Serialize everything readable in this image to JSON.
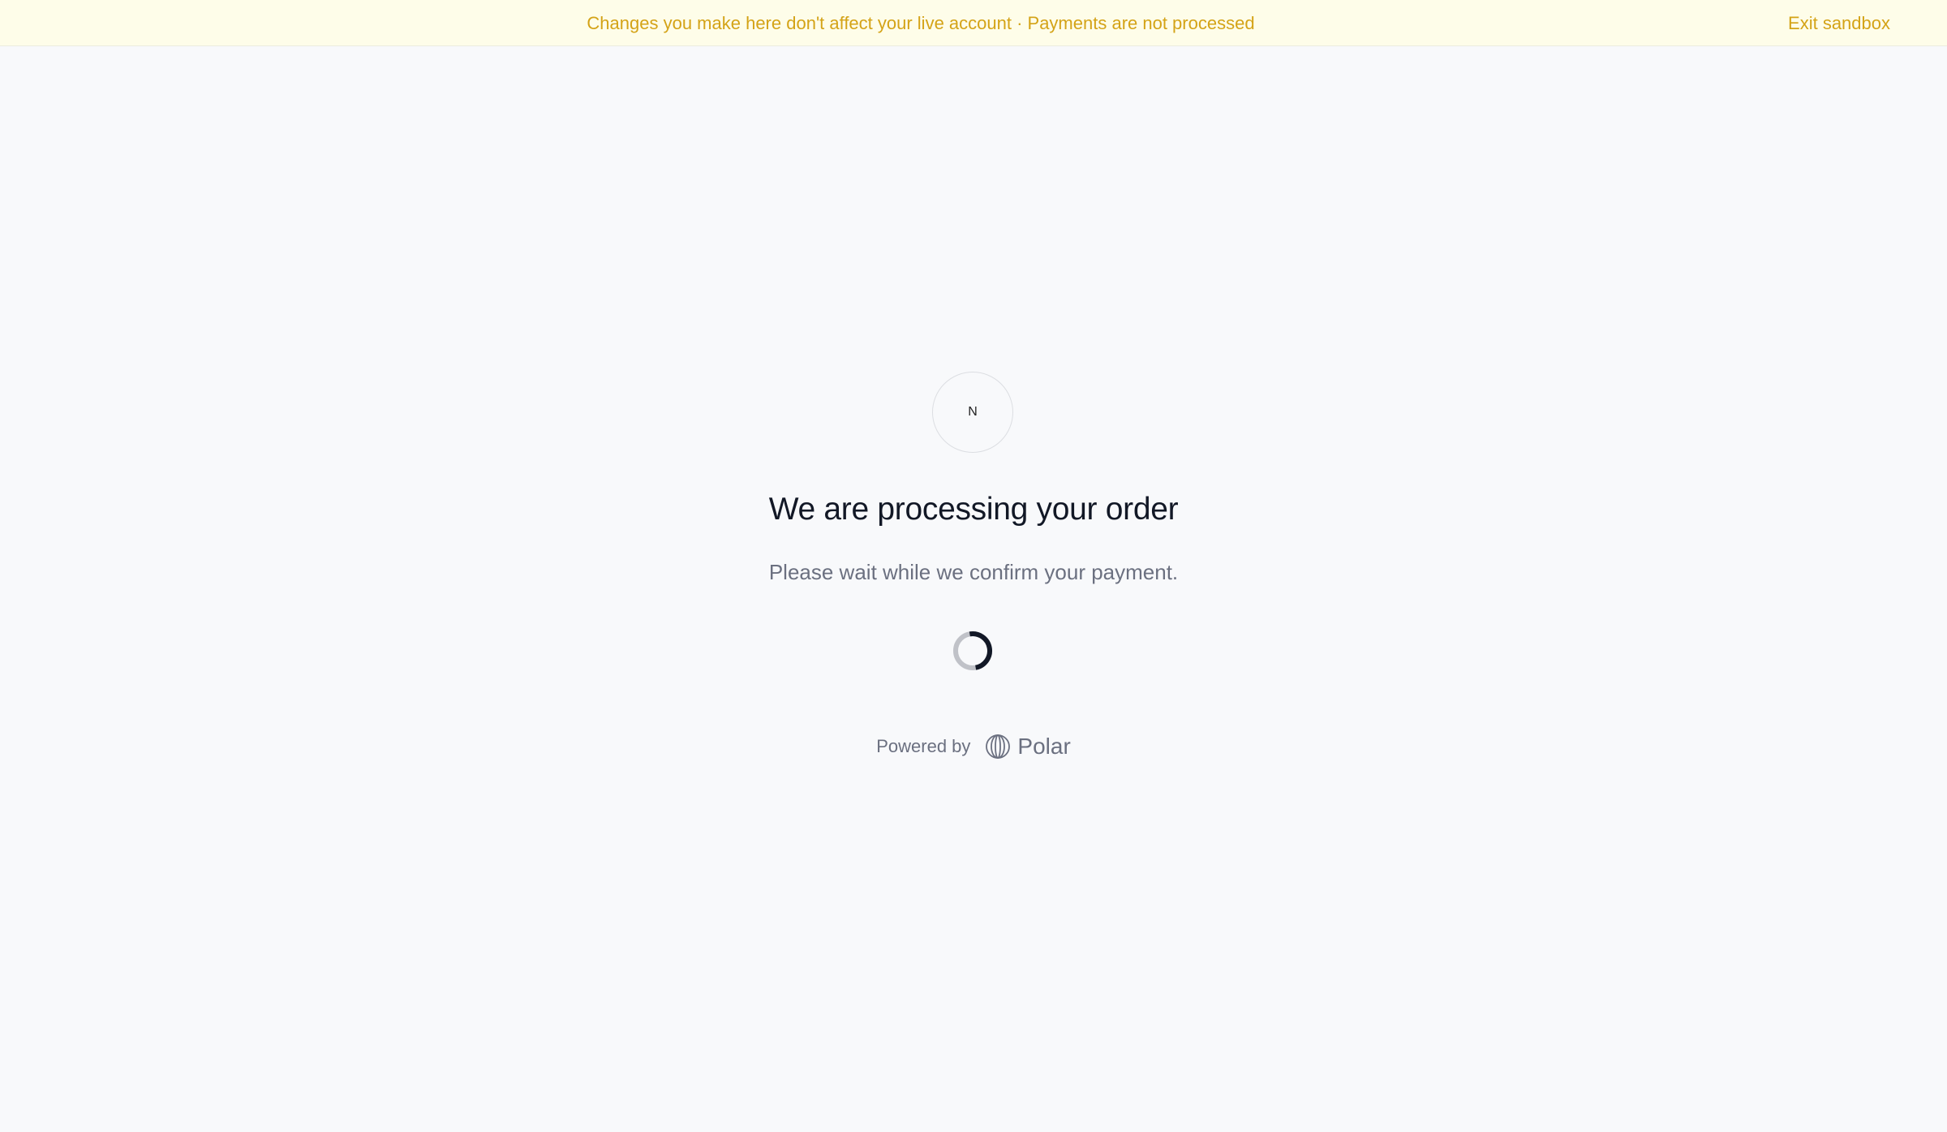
{
  "banner": {
    "message": "Changes you make here don't affect your live account · Payments are not processed",
    "exit_label": "Exit sandbox",
    "color": "#d4a317",
    "background": "#fefde9"
  },
  "merchant": {
    "avatar_initial": "N"
  },
  "status": {
    "title": "We are processing your order",
    "subtitle": "Please wait while we confirm your payment."
  },
  "spinner": {
    "icon": "loading-spinner-icon"
  },
  "footer": {
    "powered_by_label": "Powered by",
    "brand_name": "Polar",
    "brand_icon": "polar-globe-icon"
  }
}
